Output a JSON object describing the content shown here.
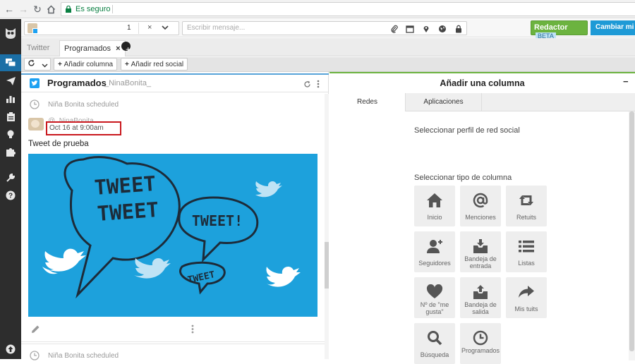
{
  "browser": {
    "secure_label": "Es seguro"
  },
  "compose": {
    "profile_count": "1",
    "message_placeholder": "Escribir mensaje...",
    "redactor_label": "Redactor",
    "redactor_badge": "BETA",
    "switch_label": "Cambiar mi p"
  },
  "tabs": [
    {
      "label": "Twitter"
    },
    {
      "label": "Programados",
      "close": "×"
    }
  ],
  "toolbar": {
    "add_column": "Añadir columna",
    "add_network": "Añadir red social"
  },
  "stream": {
    "title": "Programados",
    "handle": "_NinaBonita_",
    "scheduled_label": "Niña Bonita scheduled",
    "author": "@_NinaBonita_",
    "date": "Oct 16 at 9:00am",
    "tweet_text": "Tweet de prueba",
    "image_words": [
      "TWEET",
      "TWEET",
      "TWEET!",
      "TWEET"
    ],
    "next_scheduled_label": "Niña Bonita scheduled"
  },
  "panel": {
    "title": "Añadir una columna",
    "minimize": "−",
    "tabs": [
      "Redes",
      "Aplicaciones"
    ],
    "select_profile": "Seleccionar perfil de red social",
    "select_type": "Seleccionar tipo de columna",
    "tiles": [
      {
        "label": "Inicio",
        "icon": "home-icon"
      },
      {
        "label": "Menciones",
        "icon": "at-icon"
      },
      {
        "label": "Retuits",
        "icon": "retweet-icon"
      },
      {
        "label": "Seguidores",
        "icon": "add-user-icon"
      },
      {
        "label": "Bandeja de entrada",
        "icon": "inbox-icon"
      },
      {
        "label": "Listas",
        "icon": "list-icon"
      },
      {
        "label": "Nº de \"me gusta\"",
        "icon": "heart-icon"
      },
      {
        "label": "Bandeja de salida",
        "icon": "outbox-icon"
      },
      {
        "label": "Mis tuits",
        "icon": "share-arrow-icon"
      },
      {
        "label": "Búsqueda",
        "icon": "search-icon"
      },
      {
        "label": "Programados",
        "icon": "clock-icon"
      }
    ]
  },
  "colors": {
    "accent_blue": "#1da1dc",
    "highlight_red": "#c9181e",
    "green": "#6cb33f",
    "nav_dark": "#2d2d2d"
  }
}
